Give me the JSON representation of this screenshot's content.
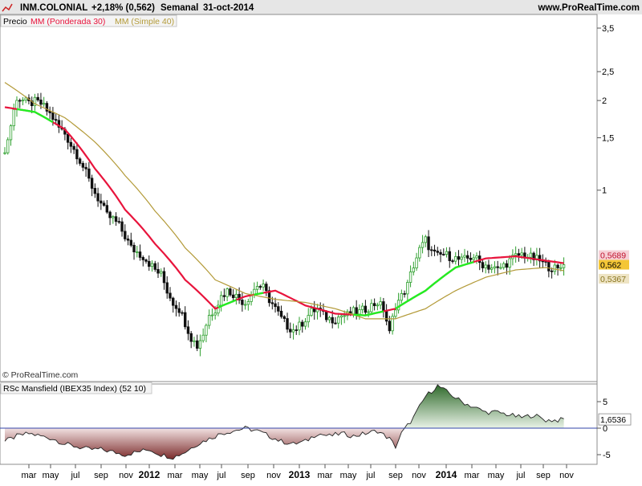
{
  "header": {
    "ticker": "INM.COLONIAL",
    "change": "+2,18% (0,562)",
    "period": "Semanal",
    "date": "31-oct-2014",
    "site": "www.ProRealTime.com"
  },
  "legend": {
    "price": "Precio",
    "wma": "MM (Ponderada 30)",
    "sma": "MM (Simple 40)"
  },
  "copyright": "© ProRealTime.com",
  "indicator_title": "RSc Mansfield (IBEX35 Index) (52 10)",
  "colors": {
    "up_candle": "#2ea02e",
    "down_candle": "#111111",
    "wma": "#e8143c",
    "sma": "#b39a38",
    "green_line": "#22ee22",
    "rsc_positive": "#5b8a57",
    "rsc_negative": "#9a4a4a",
    "zero_line": "#3344aa"
  },
  "chart_data": [
    {
      "type": "candlestick",
      "title": "INM.COLONIAL",
      "y_scale": "log",
      "ylim": [
        0.25,
        3.8
      ],
      "y_ticks": [
        "3,5",
        "2,5",
        "2",
        "1,5",
        "1"
      ],
      "x_tick_labels": [
        "mar",
        "may",
        "jul",
        "sep",
        "nov",
        "2012",
        "mar",
        "may",
        "jul",
        "sep",
        "nov",
        "2013",
        "mar",
        "may",
        "jul",
        "sep",
        "nov",
        "2014",
        "mar",
        "may",
        "jul",
        "sep",
        "nov"
      ],
      "price_labels": {
        "wma_last": "0,5689",
        "close_last": "0,562",
        "sma_last": "0,5367"
      },
      "close_path": {
        "weeks": [
          0,
          2,
          4,
          6,
          8,
          10,
          12,
          14,
          16,
          18,
          20,
          22,
          24,
          26,
          28,
          30,
          32,
          34,
          36,
          38,
          40,
          42,
          44,
          46,
          48,
          50,
          52,
          54,
          56,
          58,
          60,
          62,
          64,
          66,
          68,
          70,
          72,
          74,
          76,
          78,
          80,
          82,
          84,
          86,
          88,
          90,
          92,
          94,
          96,
          98,
          100,
          102,
          104,
          106,
          108,
          110,
          112,
          114,
          116,
          118,
          120,
          122,
          124,
          126,
          128,
          130,
          132,
          134,
          136,
          138,
          140,
          142,
          144,
          146,
          148,
          150,
          152,
          154,
          156,
          158,
          160,
          162,
          164,
          166,
          168,
          170,
          172,
          174,
          176,
          178,
          180,
          182,
          184,
          186
        ],
        "close": [
          1.33,
          1.65,
          2.05,
          2.0,
          1.95,
          1.98,
          1.95,
          1.85,
          1.75,
          1.62,
          1.55,
          1.42,
          1.32,
          1.2,
          1.08,
          0.98,
          0.9,
          0.82,
          0.8,
          0.76,
          0.7,
          0.64,
          0.62,
          0.6,
          0.57,
          0.54,
          0.52,
          0.46,
          0.42,
          0.4,
          0.36,
          0.32,
          0.3,
          0.33,
          0.38,
          0.4,
          0.44,
          0.46,
          0.45,
          0.43,
          0.42,
          0.45,
          0.48,
          0.47,
          0.43,
          0.4,
          0.37,
          0.35,
          0.34,
          0.35,
          0.37,
          0.39,
          0.4,
          0.38,
          0.37,
          0.37,
          0.38,
          0.38,
          0.39,
          0.39,
          0.4,
          0.41,
          0.42,
          0.4,
          0.33,
          0.41,
          0.44,
          0.48,
          0.56,
          0.63,
          0.68,
          0.62,
          0.6,
          0.61,
          0.6,
          0.59,
          0.58,
          0.59,
          0.6,
          0.57,
          0.56,
          0.55,
          0.54,
          0.56,
          0.58,
          0.6,
          0.61,
          0.6,
          0.59,
          0.58,
          0.56,
          0.55,
          0.54,
          0.562
        ]
      },
      "series": [
        {
          "name": "MM (Ponderada 30)",
          "weeks": [
            0,
            10,
            20,
            30,
            40,
            50,
            60,
            70,
            80,
            90,
            100,
            110,
            120,
            130,
            140,
            150,
            160,
            170,
            180,
            186
          ],
          "values": [
            1.9,
            1.83,
            1.6,
            1.18,
            0.86,
            0.66,
            0.5,
            0.4,
            0.44,
            0.46,
            0.41,
            0.385,
            0.38,
            0.4,
            0.46,
            0.55,
            0.59,
            0.6,
            0.58,
            0.5689
          ]
        },
        {
          "name": "MM (Simple 40)",
          "weeks": [
            0,
            10,
            20,
            30,
            40,
            50,
            60,
            70,
            80,
            90,
            100,
            110,
            120,
            130,
            140,
            150,
            160,
            170,
            180,
            186
          ],
          "values": [
            2.3,
            1.95,
            1.75,
            1.45,
            1.12,
            0.85,
            0.64,
            0.5,
            0.45,
            0.43,
            0.42,
            0.4,
            0.37,
            0.37,
            0.4,
            0.46,
            0.51,
            0.54,
            0.55,
            0.5367
          ]
        }
      ]
    },
    {
      "type": "area",
      "title": "RSc Mansfield (IBEX35 Index) (52 10)",
      "ylim": [
        -6.5,
        9
      ],
      "y_ticks": [
        "5",
        "0",
        "-5"
      ],
      "last_value": "1,6536",
      "weeks": [
        0,
        4,
        8,
        12,
        16,
        20,
        24,
        28,
        32,
        36,
        40,
        44,
        48,
        52,
        56,
        60,
        64,
        68,
        72,
        76,
        80,
        84,
        88,
        92,
        96,
        100,
        104,
        108,
        112,
        116,
        120,
        124,
        128,
        130,
        132,
        134,
        136,
        138,
        140,
        144,
        148,
        152,
        156,
        160,
        164,
        168,
        172,
        176,
        180,
        184,
        186
      ],
      "values": [
        -2.5,
        -1.5,
        -1.0,
        -1.5,
        -2.0,
        -3.0,
        -3.5,
        -4.0,
        -4.0,
        -4.5,
        -5.0,
        -4.5,
        -4.0,
        -5.0,
        -5.5,
        -4.5,
        -3.0,
        -2.0,
        -1.0,
        -0.5,
        0.0,
        -0.5,
        -1.5,
        -2.5,
        -3.0,
        -2.5,
        -1.0,
        -1.5,
        -1.0,
        -1.5,
        -1.0,
        -0.5,
        -2.0,
        -3.5,
        -1.0,
        0.5,
        2.0,
        4.0,
        6.0,
        8.0,
        6.5,
        5.0,
        4.0,
        3.0,
        3.0,
        2.5,
        2.0,
        2.5,
        1.5,
        1.5,
        1.6536
      ]
    }
  ]
}
